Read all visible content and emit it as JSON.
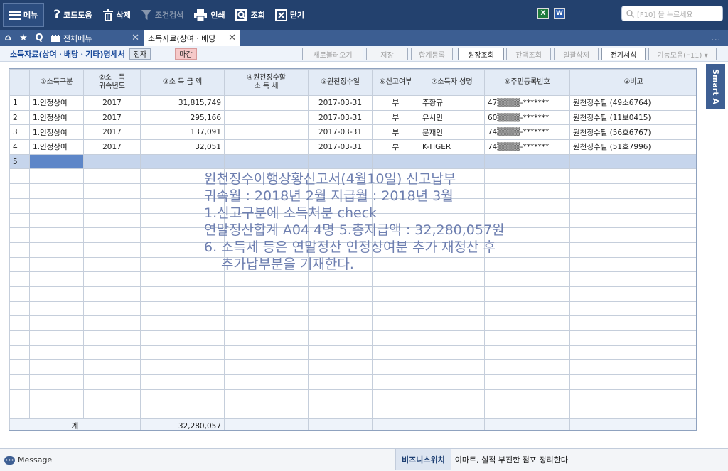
{
  "toolbar": {
    "menu": "메뉴",
    "help": "코드도움",
    "delete": "삭제",
    "filter": "조건검색",
    "print": "인쇄",
    "lookup": "조회",
    "close": "닫기",
    "search_placeholder": "[F10] 을 누르세요",
    "excel_icon": "X",
    "word_icon": "W"
  },
  "tabs": {
    "home_icon": "⌂",
    "star_icon": "★",
    "search_icon": "Q",
    "all_menu": "전체메뉴",
    "active": "소득자료(상여ㆍ배당",
    "more": "..."
  },
  "form": {
    "title": "소득자료(상여ㆍ배당ㆍ기타)명세서",
    "badge_electronic": "전자",
    "badge_closed": "마감",
    "btn_reload": "새로불러오기",
    "btn_save": "저장",
    "btn_total_register": "합계등록",
    "btn_ledger": "원장조회",
    "btn_balance": "잔액조회",
    "btn_bulk_delete": "일괄삭제",
    "btn_e_format": "전기서식",
    "btn_functions": "기능모음(F11) ▾"
  },
  "smart": "Smart A",
  "grid": {
    "headers": {
      "h1": "①소득구분",
      "h2a": "②소　득",
      "h2b": "귀속년도",
      "h3": "③소 득 금 액",
      "h4a": "④원천징수할",
      "h4b": "소 득 세",
      "h5": "⑤원천징수일",
      "h6": "⑥신고여부",
      "h7": "⑦소득자 성명",
      "h8": "⑧주민등록번호",
      "h9": "⑨비고"
    },
    "rows": [
      {
        "no": "1",
        "type": "1.인정상여",
        "year": "2017",
        "amount": "31,815,749",
        "tax": "",
        "date": "2017-03-31",
        "report": "부",
        "name": "주황규",
        "rrn": "47▒▒▒▒-*******",
        "note": "원천징수필 (49소6764)"
      },
      {
        "no": "2",
        "type": "1.인정상여",
        "year": "2017",
        "amount": "295,166",
        "tax": "",
        "date": "2017-03-31",
        "report": "부",
        "name": "유시민",
        "rrn": "60▒▒▒▒-*******",
        "note": "원천징수필 (11보0415)"
      },
      {
        "no": "3",
        "type": "1.인정상여",
        "year": "2017",
        "amount": "137,091",
        "tax": "",
        "date": "2017-03-31",
        "report": "부",
        "name": "문재인",
        "rrn": "74▒▒▒▒-*******",
        "note": "원천징수필 (56호6767)"
      },
      {
        "no": "4",
        "type": "1.인정상여",
        "year": "2017",
        "amount": "32,051",
        "tax": "",
        "date": "2017-03-31",
        "report": "부",
        "name": "K-TIGER",
        "rrn": "74▒▒▒▒-*******",
        "note": "원천징수필 (51호7996)"
      }
    ],
    "selected_row_no": "5",
    "footer": {
      "label": "계",
      "amount": "32,280,057"
    }
  },
  "memo": {
    "line1": "원천징수이행상황신고서(4월10일) 신고납부",
    "line2": "귀속월 : 2018년 2월 지급월 : 2018년 3월",
    "line3": "1.신고구분에 소득처분 check",
    "line4": "연말정산합계 A04  4명 5.총지급액 : 32,280,057원",
    "line5": "6. 소득세 등은 연말정산 인정상여분 추가 재정산 후",
    "line6": "추가납부분을 기재한다."
  },
  "status": {
    "message": "Message",
    "biz_label": "비즈니스위치",
    "biz_text": "이마트, 실적 부진한 점포 정리한다"
  }
}
